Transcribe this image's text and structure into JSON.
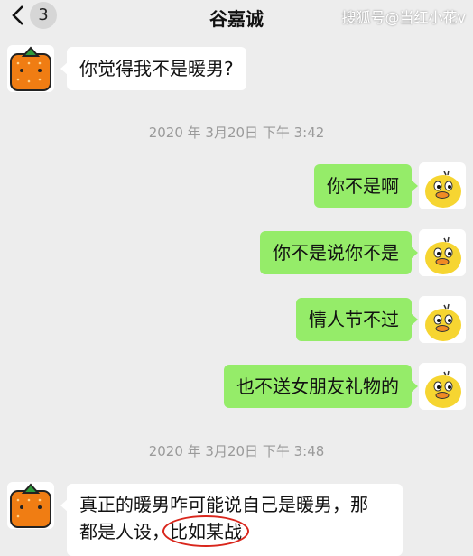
{
  "header": {
    "back_count": "3",
    "title": "谷嘉诚",
    "watermark": "搜狐号@当红小花v"
  },
  "messages": {
    "m1": "你觉得我不是暖男?",
    "ts1": "2020 年 3月20日 下午 3:42",
    "m2": "你不是啊",
    "m3": "你不是说你不是",
    "m4": "情人节不过",
    "m5": "也不送女朋友礼物的",
    "ts2": "2020 年 3月20日 下午 3:48",
    "m6_line1": "真正的暖男咋可能说自己是暖男，那",
    "m6_line2a": "都是人设，",
    "m6_line2b": "比如某战"
  },
  "colors": {
    "background": "#ededed",
    "sent_bubble": "#95ec69",
    "received_bubble": "#ffffff",
    "highlight_circle": "#d9261c"
  },
  "icons": {
    "back": "chevron-left-icon",
    "contact_avatar": "orange-avatar-icon",
    "self_avatar": "yellow-duck-avatar-icon"
  }
}
